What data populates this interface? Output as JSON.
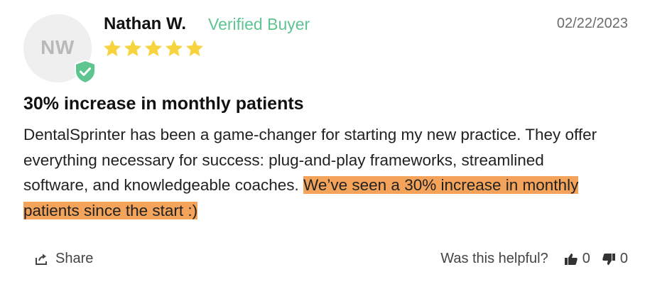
{
  "review": {
    "avatar_initials": "NW",
    "author": "Nathan W.",
    "verified_label": "Verified Buyer",
    "date": "02/22/2023",
    "rating": 5,
    "rating_max": 5,
    "title": "30% increase in monthly patients",
    "body_text": "DentalSprinter has been a game-changer for starting my new practice. They offer everything necessary for success: plug-and-play frameworks, streamlined software, and knowledgeable coaches.",
    "body_highlight": "We’ve seen a 30% increase in monthly patients since the start :)"
  },
  "actions": {
    "share_label": "Share",
    "helpful_label": "Was this helpful?",
    "upvotes": "0",
    "downvotes": "0"
  },
  "colors": {
    "verified": "#5ec591",
    "badge": "#5ec591",
    "star": "#f7d33d",
    "highlight": "#f3a45a",
    "avatar_bg": "#efefef"
  },
  "icons": [
    "verified-badge-icon",
    "star-icon",
    "share-icon",
    "thumbs-up-icon",
    "thumbs-down-icon"
  ]
}
